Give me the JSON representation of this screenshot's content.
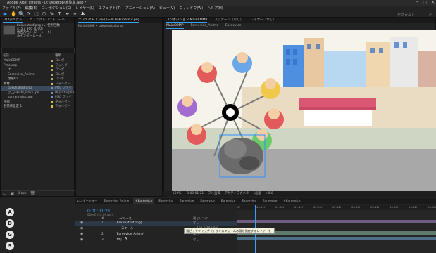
{
  "window": {
    "title": "Adobe After Effects - D:\\Desktop\\観覧車.aep *",
    "min": "─",
    "max": "□",
    "close": "✕"
  },
  "menu": [
    "ファイル(F)",
    "編集(E)",
    "コンポジション(C)",
    "レイヤー(L)",
    "エフェクト(T)",
    "アニメーション(A)",
    "ビュー(V)",
    "ウィンドウ(W)",
    "ヘルプ(H)"
  ],
  "toolbar": {
    "workspace": "デフォルト",
    "tools": [
      "▶",
      "✋",
      "🔍",
      "⟳",
      "⬚",
      "⬡",
      "✎",
      "T",
      "✒",
      "⌖",
      "✱"
    ]
  },
  "project": {
    "tabs": [
      "プロジェクト",
      "エフェクトコントロール"
    ],
    "file": {
      "name": "bakuhatsuf.png ▾ 、使用回数",
      "size": "415 x 300 (1.00)",
      "depth": "数百万色＋ (ストレート)",
      "alpha": "非インターレース"
    },
    "headers": {
      "name": "名前",
      "type": "種類"
    },
    "rows": [
      {
        "label": "MainCOMP",
        "type": "コンポ",
        "color": "#b6a27a",
        "indent": 0
      },
      {
        "label": "Precomp",
        "type": "フォルダー",
        "color": "#d8c24b",
        "indent": 0
      },
      {
        "label": "ttt",
        "type": "コンポ",
        "color": "#b6a27a",
        "indent": 1
      },
      {
        "label": "Eareevice_Anime",
        "type": "コンポ",
        "color": "#b6a27a",
        "indent": 1
      },
      {
        "label": "爆破01",
        "type": "コンポ",
        "color": "#b6a27a",
        "indent": 1
      },
      {
        "label": "素材",
        "type": "フォルダー",
        "color": "#d8c24b",
        "indent": 0
      },
      {
        "label": "bakuhatsuf.png",
        "type": "PNG ファイル",
        "color": "#7a8fb5",
        "indent": 1,
        "selected": true
      },
      {
        "label": "fjz_yukishi_sinku.jpe",
        "type": "ImporterJPEG",
        "color": "#7a8fb5",
        "indent": 1
      },
      {
        "label": "kanrannsha.png",
        "type": "PNG ファイル",
        "color": "#7a8fb5",
        "indent": 1
      },
      {
        "label": "平面",
        "type": "フォルダー",
        "color": "#d8c24b",
        "indent": 0
      },
      {
        "label": "名前未設定 1",
        "type": "フォルダー",
        "color": "#d8c24b",
        "indent": 0
      }
    ],
    "footer": "8 bpc"
  },
  "effects_panel": {
    "tab": "エフェクトコントロール bakuhatsuf.png",
    "header": "MainCOMP • bakuhatsuf.png"
  },
  "composition": {
    "tabs": [
      "コンポジション MainCOMP",
      "フッテージ（なし）",
      "レイヤー（なし）"
    ],
    "subtabs": [
      "MainCOMP",
      "Eareevice_Anime",
      "Eareevice"
    ],
    "viewbar": [
      "(50%)",
      "0;00;01;21",
      "フル画質",
      "アクティブカメラ",
      "1画面",
      "+0.0"
    ]
  },
  "timeline": {
    "tabs": [
      "レンダーキュー",
      "Eareevice_Anime",
      "#Eareevice",
      "Eareevice",
      "Eareevice",
      "Eareevice",
      "Eareevice",
      "Eareevice",
      "Eareevice",
      "#Eareevice"
    ],
    "timecode": "0:00:01:21",
    "subtc": "00046 (24.00 fps)",
    "header": {
      "num": "#",
      "name": "レイヤー名",
      "parent": "親とリンク"
    },
    "layers": [
      {
        "num": "1",
        "name": "[bakuhatsuf.png]",
        "parent": "なし"
      },
      {
        "num": "",
        "name": "スケール",
        "parent": "∞ 100.0,100.0%"
      },
      {
        "num": "2",
        "name": "[Eareevice_Anime]",
        "parent": "なし"
      },
      {
        "num": "3",
        "name": "[ttt]",
        "parent": "なし"
      }
    ],
    "ruler": [
      "0f",
      "00:12f",
      "01:00f",
      "01:12f",
      "02:00f",
      "02:12f",
      "03:00f",
      "03:12f",
      "04:00f",
      "04:12f",
      "05:00f"
    ],
    "tooltip": "親ピックウイップ（トランスフォームの親を指定するレイヤーを選択）",
    "side_icons": [
      "A",
      "D",
      "G",
      "S"
    ]
  }
}
